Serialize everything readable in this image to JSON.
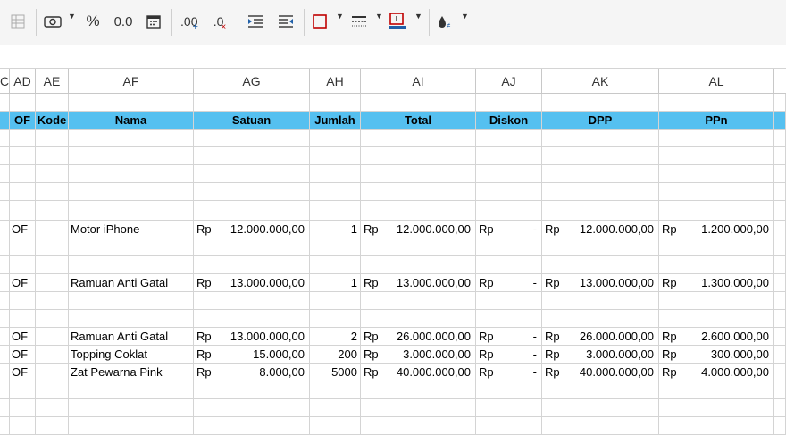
{
  "toolbar": {
    "icons": [
      "table-icon",
      "camera-icon",
      "percent-icon",
      "decimal-icon",
      "calendar-icon",
      "add-decimal-icon",
      "remove-decimal-icon",
      "indent-increase-icon",
      "indent-decrease-icon",
      "border-icon",
      "line-style-icon",
      "border-color-icon",
      "conditional-icon"
    ],
    "glyphs": {
      "percent": "%",
      "decimal": "0.0",
      "add_decimal": ".00",
      "remove_decimal": ".0"
    }
  },
  "columns": [
    "C",
    "AD",
    "AE",
    "AF",
    "AG",
    "AH",
    "AI",
    "AJ",
    "AK",
    "AL"
  ],
  "header_row": {
    "of": "OF",
    "kode": "Kode",
    "nama": "Nama",
    "satuan": "Satuan",
    "jumlah": "Jumlah",
    "total": "Total",
    "diskon": "Diskon",
    "dpp": "DPP",
    "ppn": "PPn"
  },
  "rows": [
    {
      "of": "OF",
      "nama": "Motor iPhone",
      "cur1": "Rp",
      "satuan": "12.000.000,00",
      "jumlah": "1",
      "cur2": "Rp",
      "total": "12.000.000,00",
      "cur3": "Rp",
      "diskon": "-",
      "cur4": "Rp",
      "dpp": "12.000.000,00",
      "cur5": "Rp",
      "ppn": "1.200.000,00"
    },
    {
      "of": "OF",
      "nama": "Ramuan Anti Gatal",
      "cur1": "Rp",
      "satuan": "13.000.000,00",
      "jumlah": "1",
      "cur2": "Rp",
      "total": "13.000.000,00",
      "cur3": "Rp",
      "diskon": "-",
      "cur4": "Rp",
      "dpp": "13.000.000,00",
      "cur5": "Rp",
      "ppn": "1.300.000,00"
    },
    {
      "of": "OF",
      "nama": "Ramuan Anti Gatal",
      "cur1": "Rp",
      "satuan": "13.000.000,00",
      "jumlah": "2",
      "cur2": "Rp",
      "total": "26.000.000,00",
      "cur3": "Rp",
      "diskon": "-",
      "cur4": "Rp",
      "dpp": "26.000.000,00",
      "cur5": "Rp",
      "ppn": "2.600.000,00"
    },
    {
      "of": "OF",
      "nama": "Topping Coklat",
      "cur1": "Rp",
      "satuan": "15.000,00",
      "jumlah": "200",
      "cur2": "Rp",
      "total": "3.000.000,00",
      "cur3": "Rp",
      "diskon": "-",
      "cur4": "Rp",
      "dpp": "3.000.000,00",
      "cur5": "Rp",
      "ppn": "300.000,00"
    },
    {
      "of": "OF",
      "nama": "Zat Pewarna Pink",
      "cur1": "Rp",
      "satuan": "8.000,00",
      "jumlah": "5000",
      "cur2": "Rp",
      "total": "40.000.000,00",
      "cur3": "Rp",
      "diskon": "-",
      "cur4": "Rp",
      "dpp": "40.000.000,00",
      "cur5": "Rp",
      "ppn": "4.000.000,00"
    }
  ],
  "colors": {
    "header_fill": "#55c0f0",
    "grid_line": "#d4d4d4",
    "border_red": "#c00000",
    "border_blue": "#1f5fa8"
  }
}
